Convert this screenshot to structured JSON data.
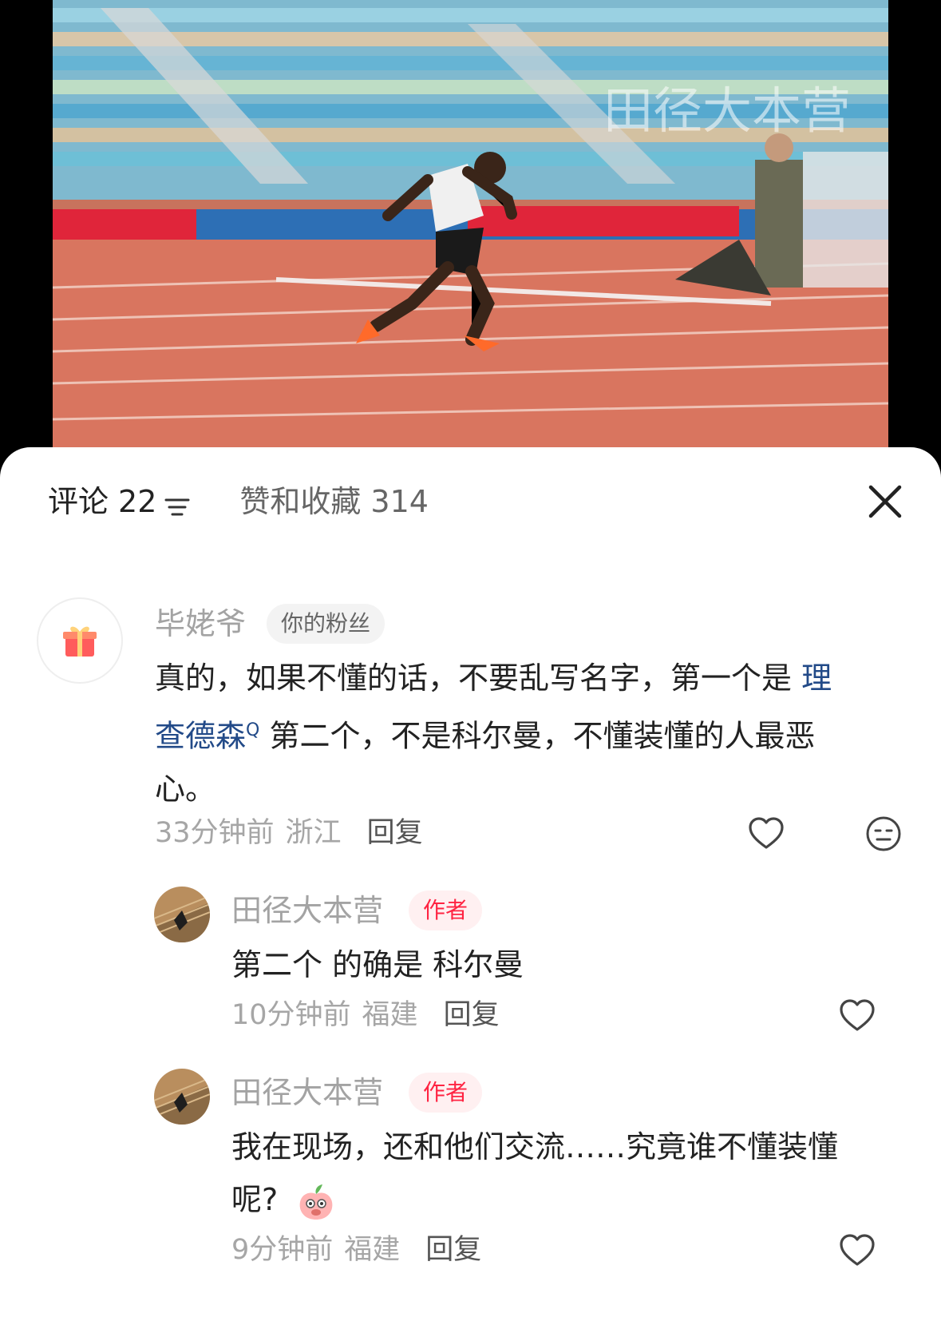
{
  "video": {
    "watermark": "田径大本营"
  },
  "tabs": {
    "comments_label": "评论",
    "comments_count": "22",
    "likes_label": "赞和收藏",
    "likes_count": "314"
  },
  "comments": [
    {
      "user": "毕姥爷",
      "badge": "你的粉丝",
      "text_before": "真的，如果不懂的话，不要乱写名字，第一个是",
      "link_line1": "理",
      "link_line2": "查德森",
      "search_mark": "Q",
      "text_after_line2": "第二个，不是科尔曼，不懂装懂的人最恶",
      "text_line3": "心。",
      "time": "33分钟前",
      "location": "浙江",
      "reply": "回复"
    }
  ],
  "replies": [
    {
      "user": "田径大本营",
      "badge": "作者",
      "text": "第二个 的确是 科尔曼",
      "time": "10分钟前",
      "location": "福建",
      "reply": "回复"
    },
    {
      "user": "田径大本营",
      "badge": "作者",
      "text_line1": "我在现场，还和他们交流……究竟谁不懂装懂",
      "text_line2": "呢?",
      "time": "9分钟前",
      "location": "福建",
      "reply": "回复"
    }
  ],
  "colors": {
    "accent": "#ff2442",
    "link": "#224a88"
  }
}
